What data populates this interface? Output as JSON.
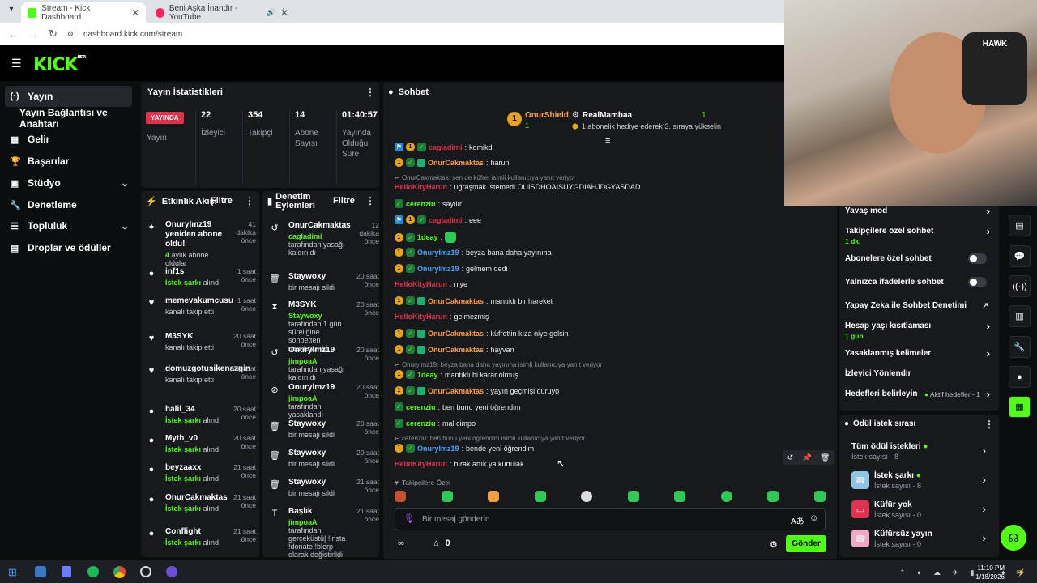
{
  "browser": {
    "tabs": [
      {
        "title": "Stream - Kick Dashboard",
        "active": true
      },
      {
        "title": "Beni Aşka İnandır - YouTube",
        "active": false
      }
    ],
    "url": "dashboard.kick.com/stream"
  },
  "header": {
    "logo": "KICK",
    "logo_badge": "BETA"
  },
  "sidebar": {
    "items": [
      {
        "label": "Yayın",
        "icon": "broadcast-icon"
      },
      {
        "label": "Yayın Bağlantısı ve Anahtarı",
        "icon": "key-icon"
      },
      {
        "label": "Gelir",
        "icon": "revenue-icon"
      },
      {
        "label": "Başarılar",
        "icon": "trophy-icon"
      },
      {
        "label": "Stüdyo",
        "icon": "studio-icon"
      },
      {
        "label": "Denetleme",
        "icon": "wrench-icon"
      },
      {
        "label": "Topluluk",
        "icon": "community-icon"
      },
      {
        "label": "Droplar ve ödüller",
        "icon": "gift-icon"
      }
    ]
  },
  "stats": {
    "title": "Yayın İstatistikleri",
    "live_badge": "YAYINDA",
    "live_label": "Yayın",
    "items": [
      {
        "value": "22",
        "label": "İzleyici"
      },
      {
        "value": "354",
        "label": "Takipçi"
      },
      {
        "value": "14",
        "label": "Abone Sayısı"
      },
      {
        "value": "01:40:57",
        "label": "Yayında Olduğu Süre"
      }
    ]
  },
  "activity": {
    "title": "Etkinlik Akışı",
    "filter": "Filtre",
    "items": [
      {
        "name": "Onurylmz19 yeniden abone oldu!",
        "sub_strong": "4",
        "sub": " aylık abone oldular",
        "time": "41 dakika önce",
        "icon": "sparkle-icon"
      },
      {
        "name": "inf1s",
        "sub_strong": "İstek şarkı",
        "sub": " alındı",
        "time": "1 saat önce",
        "icon": "reward-icon"
      },
      {
        "name": "memevakumcusu",
        "sub_strong": "",
        "sub": "kanalı takip etti",
        "time": "1 saat önce",
        "icon": "heart-icon"
      },
      {
        "name": "M3SYK",
        "sub_strong": "",
        "sub": "kanalı takip etti",
        "time": "20 saat önce",
        "icon": "heart-icon"
      },
      {
        "name": "domuzgotusikenazgin",
        "sub_strong": "",
        "sub": "kanalı takip etti",
        "time": "20 saat önce",
        "icon": "heart-icon"
      },
      {
        "name": "halil_34",
        "sub_strong": "İstek şarkı",
        "sub": " alındı",
        "time": "20 saat önce",
        "icon": "reward-icon"
      },
      {
        "name": "Myth_v0",
        "sub_strong": "İstek şarkı",
        "sub": " alındı",
        "time": "20 saat önce",
        "icon": "reward-icon"
      },
      {
        "name": "beyzaaxx",
        "sub_strong": "İstek şarkı",
        "sub": " alındı",
        "time": "21 saat önce",
        "icon": "reward-icon"
      },
      {
        "name": "OnurCakmaktas",
        "sub_strong": "İstek şarkı",
        "sub": " alındı",
        "time": "21 saat önce",
        "icon": "reward-icon"
      },
      {
        "name": "Conflight",
        "sub_strong": "İstek şarkı",
        "sub": " alındı",
        "time": "21 saat önce",
        "icon": "reward-icon"
      }
    ]
  },
  "moderation": {
    "title": "Denetim Eylemleri",
    "filter": "Filtre",
    "items": [
      {
        "name": "OnurCakmaktas",
        "actor": "cagladimi",
        "text": " tarafından yasağı kaldırıldı",
        "time": "12 dakika önce",
        "icon": "undo-icon"
      },
      {
        "name": "Staywoxy",
        "actor": "",
        "text": "bir mesajı sildi",
        "time": "20 saat önce",
        "icon": "trash-icon"
      },
      {
        "name": "M3SYK",
        "actor": "Staywoxy",
        "text": " tarafından 1 gün süreliğine sohbetten uzaklaştırıldı",
        "time": "20 saat önce",
        "icon": "hourglass-icon"
      },
      {
        "name": "Onurylmz19",
        "actor": "jimpoaA",
        "text": " tarafından yasağı kaldırıldı",
        "time": "20 saat önce",
        "icon": "undo-icon"
      },
      {
        "name": "Onurylmz19",
        "actor": "jimpoaA",
        "text": " tarafından yasaklandı",
        "time": "20 saat önce",
        "icon": "ban-icon"
      },
      {
        "name": "Staywoxy",
        "actor": "",
        "text": "bir mesajı sildi",
        "time": "20 saat önce",
        "icon": "trash-icon"
      },
      {
        "name": "Staywoxy",
        "actor": "",
        "text": "bir mesajı sildi",
        "time": "20 saat önce",
        "icon": "trash-icon"
      },
      {
        "name": "Staywoxy",
        "actor": "",
        "text": "bir mesajı sildi",
        "time": "21 saat önce",
        "icon": "trash-icon"
      },
      {
        "name": "Başlık",
        "actor": "jimpoaA",
        "text": " tarafından gerçeküstü| !insta !donate !blerp olarak değiştirildi",
        "time": "21 saat önce",
        "icon": "title-icon"
      }
    ]
  },
  "chat": {
    "title": "Sohbet",
    "pinned": {
      "rank": "1",
      "leader": "OnurShield",
      "leader_count": "1",
      "gifter": "RealMambaa",
      "gifter_count": "1",
      "note": "1 abonelik hediye ederek 3. sıraya yükselin"
    },
    "partial_top": {
      "user": "cagladimi",
      "text": "komikdi"
    },
    "messages": [
      {
        "type": "msg",
        "user": "OnurCakmaktas",
        "color": "orange",
        "badges": [
          "sub1",
          "verified",
          "mod"
        ],
        "text": "harun"
      },
      {
        "type": "reply",
        "text": "OnurCakmaktas: sen de küfret isimli kullanıcıya yanıt veriyor"
      },
      {
        "type": "msg",
        "user": "HelloKityHarun",
        "color": "red",
        "badges": [],
        "text": "uğraşmak istemedi OUISDHOAISUYGDIAHJDGYASDAD"
      },
      {
        "type": "msg",
        "user": "cerenziu",
        "color": "green",
        "badges": [
          "verified"
        ],
        "text": "sayılır"
      },
      {
        "type": "msg",
        "user": "cagladimi",
        "color": "red",
        "badges": [
          "staff",
          "sub1",
          "verified"
        ],
        "text": "eee"
      },
      {
        "type": "msg",
        "user": "1deay",
        "color": "green",
        "badges": [
          "sub1",
          "verified"
        ],
        "text": "",
        "emote": true
      },
      {
        "type": "msg",
        "user": "Onurylmz19",
        "color": "blue",
        "badges": [
          "sub1",
          "verified"
        ],
        "text": "beyza bana daha yayınına"
      },
      {
        "type": "msg",
        "user": "Onurylmz19",
        "color": "blue",
        "badges": [
          "sub1",
          "verified"
        ],
        "text": "gelmem dedi"
      },
      {
        "type": "msg",
        "user": "HelloKityHarun",
        "color": "red",
        "badges": [],
        "text": "niye"
      },
      {
        "type": "msg",
        "user": "OnurCakmaktas",
        "color": "orange",
        "badges": [
          "sub1",
          "verified",
          "mod"
        ],
        "text": "mantıklı bir hareket"
      },
      {
        "type": "msg",
        "user": "HelloKityHarun",
        "color": "red",
        "badges": [],
        "text": "gelmezmiş"
      },
      {
        "type": "msg",
        "user": "OnurCakmaktas",
        "color": "orange",
        "badges": [
          "sub1",
          "verified",
          "mod"
        ],
        "text": "küfrettin kıza niye gelsin"
      },
      {
        "type": "msg",
        "user": "OnurCakmaktas",
        "color": "orange",
        "badges": [
          "sub1",
          "verified",
          "mod"
        ],
        "text": "hayvan"
      },
      {
        "type": "reply",
        "text": "Onurylmz19: beyza bana daha yayınına isimli kullanıcıya yanıt veriyor"
      },
      {
        "type": "msg",
        "user": "1deay",
        "color": "green",
        "badges": [
          "sub1",
          "verified"
        ],
        "text": "mantıklı bi karar olmuş"
      },
      {
        "type": "msg",
        "user": "OnurCakmaktas",
        "color": "orange",
        "badges": [
          "sub1",
          "verified",
          "mod"
        ],
        "text": "yayın geçmişi duruyo"
      },
      {
        "type": "msg",
        "user": "cerenziu",
        "color": "green",
        "badges": [
          "verified"
        ],
        "text": "ben bunu yeni öğrendim"
      },
      {
        "type": "msg",
        "user": "cerenziu",
        "color": "green",
        "badges": [
          "verified"
        ],
        "text": "mal cimpo"
      },
      {
        "type": "reply",
        "text": "cerenziu: ben bunu yeni öğrendim isimli kullanıcıya yanıt veriyor"
      },
      {
        "type": "msg",
        "user": "Onurylmz19",
        "color": "blue",
        "badges": [
          "sub1",
          "verified"
        ],
        "text": "bende yeni öğrendim"
      },
      {
        "type": "msg",
        "user": "HelloKityHarun",
        "color": "red",
        "badges": [],
        "text": "bırak artık ya kurtulak"
      }
    ],
    "followers_only": "Takipçilere Özel",
    "input_placeholder": "Bir mesaj gönderin",
    "points": "0",
    "send": "Gönder"
  },
  "chat_settings": {
    "items": [
      {
        "label": "Yavaş mod",
        "sub": "",
        "kind": "chevron"
      },
      {
        "label": "Takipçilere özel sohbet",
        "sub": "1 dk.",
        "kind": "chevron"
      },
      {
        "label": "Abonelere özel sohbet",
        "sub": "",
        "kind": "toggle"
      },
      {
        "label": "Yalnızca ifadelerle sohbet",
        "sub": "",
        "kind": "toggle"
      },
      {
        "label": "Yapay Zeka ile Sohbet Denetimi",
        "sub": "",
        "kind": "external"
      },
      {
        "label": "Hesap yaşı kısıtlaması",
        "sub": "1 gün",
        "kind": "chevron"
      },
      {
        "label": "Yasaklanmış kelimeler",
        "sub": "",
        "kind": "chevron"
      },
      {
        "label": "İzleyici Yönlendir",
        "sub": "",
        "kind": "none"
      },
      {
        "label": "Hedefleri belirleyin",
        "sub": "",
        "kind": "chevron",
        "status": "Aktif hedefler - 1"
      }
    ]
  },
  "rewards": {
    "title": "Ödül istek sırası",
    "items": [
      {
        "title": "Tüm ödül istekleri",
        "sub": "İstek sayısı - 8",
        "dot": true,
        "icon": ""
      },
      {
        "title": "İstek şarkı",
        "sub": "İstek sayısı - 8",
        "dot": true,
        "icon": "phone-icon",
        "color": "#8ec5e6"
      },
      {
        "title": "Küfür yok",
        "sub": "İstek sayısı - 0",
        "dot": false,
        "icon": "tv-icon",
        "color": "#e0324c"
      },
      {
        "title": "Küfürsüz yayın",
        "sub": "İstek sayısı - 0",
        "dot": false,
        "icon": "phone-icon",
        "color": "#f2a7c3"
      }
    ]
  },
  "taskbar": {
    "time": "11:10 PM",
    "date": "1/18/2026"
  },
  "colors": {
    "accent": "#53fc18",
    "panel": "#18191d",
    "bg": "#0b0e0f"
  }
}
